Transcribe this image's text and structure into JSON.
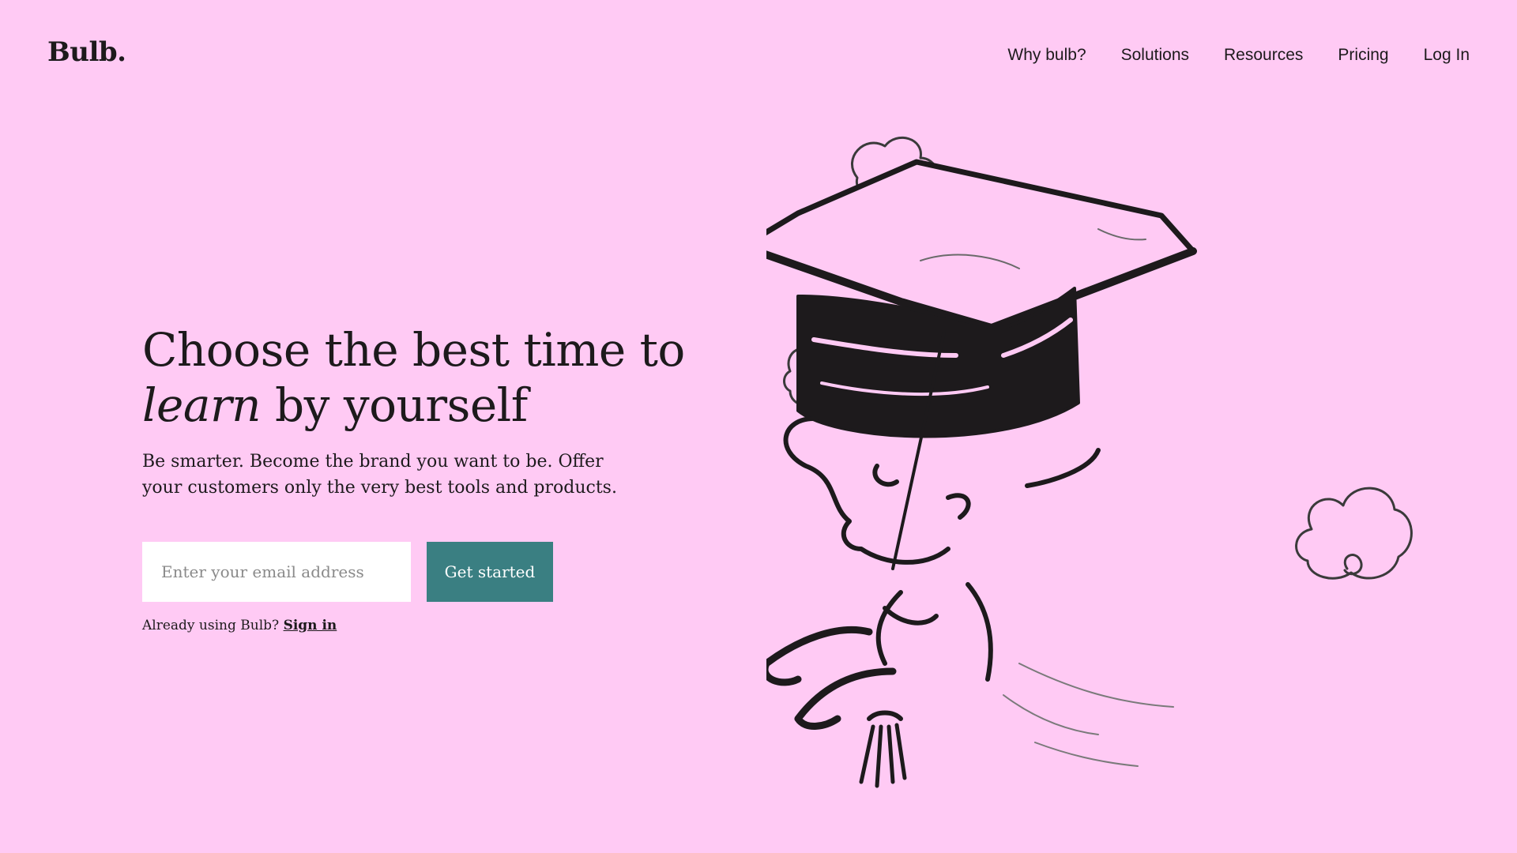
{
  "brand": {
    "logo": "Bulb."
  },
  "nav": {
    "items": [
      "Why bulb?",
      "Solutions",
      "Resources",
      "Pricing",
      "Log In"
    ]
  },
  "hero": {
    "headline_part1": "Choose the best time to",
    "headline_italic": "learn",
    "headline_part2": " by yourself",
    "subtext": "Be smarter. Become the brand you want to be. Offer your customers only the very best tools and products.",
    "email_placeholder": "Enter your email address",
    "email_value": "",
    "cta_label": "Get started",
    "signin_prompt": "Already using Bulb? ",
    "signin_link": "Sign in"
  },
  "illustration": {
    "icon": "graduate-hat-illustration"
  },
  "colors": {
    "background": "#ffcaf4",
    "accent": "#3a7f82",
    "text": "#1d1a1c",
    "input_background": "#ffffff"
  }
}
